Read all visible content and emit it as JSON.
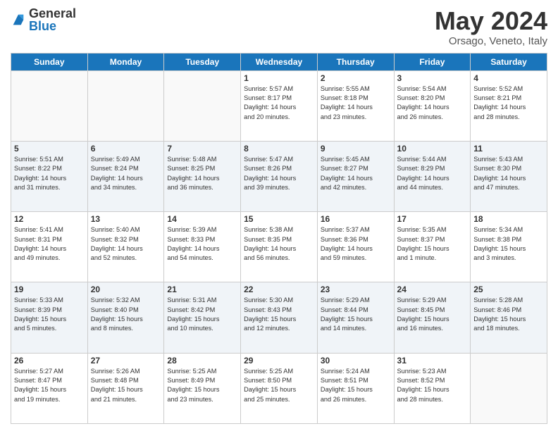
{
  "header": {
    "logo_general": "General",
    "logo_blue": "Blue",
    "month_title": "May 2024",
    "subtitle": "Orsago, Veneto, Italy"
  },
  "weekdays": [
    "Sunday",
    "Monday",
    "Tuesday",
    "Wednesday",
    "Thursday",
    "Friday",
    "Saturday"
  ],
  "weeks": [
    [
      {
        "day": "",
        "info": ""
      },
      {
        "day": "",
        "info": ""
      },
      {
        "day": "",
        "info": ""
      },
      {
        "day": "1",
        "info": "Sunrise: 5:57 AM\nSunset: 8:17 PM\nDaylight: 14 hours\nand 20 minutes."
      },
      {
        "day": "2",
        "info": "Sunrise: 5:55 AM\nSunset: 8:18 PM\nDaylight: 14 hours\nand 23 minutes."
      },
      {
        "day": "3",
        "info": "Sunrise: 5:54 AM\nSunset: 8:20 PM\nDaylight: 14 hours\nand 26 minutes."
      },
      {
        "day": "4",
        "info": "Sunrise: 5:52 AM\nSunset: 8:21 PM\nDaylight: 14 hours\nand 28 minutes."
      }
    ],
    [
      {
        "day": "5",
        "info": "Sunrise: 5:51 AM\nSunset: 8:22 PM\nDaylight: 14 hours\nand 31 minutes."
      },
      {
        "day": "6",
        "info": "Sunrise: 5:49 AM\nSunset: 8:24 PM\nDaylight: 14 hours\nand 34 minutes."
      },
      {
        "day": "7",
        "info": "Sunrise: 5:48 AM\nSunset: 8:25 PM\nDaylight: 14 hours\nand 36 minutes."
      },
      {
        "day": "8",
        "info": "Sunrise: 5:47 AM\nSunset: 8:26 PM\nDaylight: 14 hours\nand 39 minutes."
      },
      {
        "day": "9",
        "info": "Sunrise: 5:45 AM\nSunset: 8:27 PM\nDaylight: 14 hours\nand 42 minutes."
      },
      {
        "day": "10",
        "info": "Sunrise: 5:44 AM\nSunset: 8:29 PM\nDaylight: 14 hours\nand 44 minutes."
      },
      {
        "day": "11",
        "info": "Sunrise: 5:43 AM\nSunset: 8:30 PM\nDaylight: 14 hours\nand 47 minutes."
      }
    ],
    [
      {
        "day": "12",
        "info": "Sunrise: 5:41 AM\nSunset: 8:31 PM\nDaylight: 14 hours\nand 49 minutes."
      },
      {
        "day": "13",
        "info": "Sunrise: 5:40 AM\nSunset: 8:32 PM\nDaylight: 14 hours\nand 52 minutes."
      },
      {
        "day": "14",
        "info": "Sunrise: 5:39 AM\nSunset: 8:33 PM\nDaylight: 14 hours\nand 54 minutes."
      },
      {
        "day": "15",
        "info": "Sunrise: 5:38 AM\nSunset: 8:35 PM\nDaylight: 14 hours\nand 56 minutes."
      },
      {
        "day": "16",
        "info": "Sunrise: 5:37 AM\nSunset: 8:36 PM\nDaylight: 14 hours\nand 59 minutes."
      },
      {
        "day": "17",
        "info": "Sunrise: 5:35 AM\nSunset: 8:37 PM\nDaylight: 15 hours\nand 1 minute."
      },
      {
        "day": "18",
        "info": "Sunrise: 5:34 AM\nSunset: 8:38 PM\nDaylight: 15 hours\nand 3 minutes."
      }
    ],
    [
      {
        "day": "19",
        "info": "Sunrise: 5:33 AM\nSunset: 8:39 PM\nDaylight: 15 hours\nand 5 minutes."
      },
      {
        "day": "20",
        "info": "Sunrise: 5:32 AM\nSunset: 8:40 PM\nDaylight: 15 hours\nand 8 minutes."
      },
      {
        "day": "21",
        "info": "Sunrise: 5:31 AM\nSunset: 8:42 PM\nDaylight: 15 hours\nand 10 minutes."
      },
      {
        "day": "22",
        "info": "Sunrise: 5:30 AM\nSunset: 8:43 PM\nDaylight: 15 hours\nand 12 minutes."
      },
      {
        "day": "23",
        "info": "Sunrise: 5:29 AM\nSunset: 8:44 PM\nDaylight: 15 hours\nand 14 minutes."
      },
      {
        "day": "24",
        "info": "Sunrise: 5:29 AM\nSunset: 8:45 PM\nDaylight: 15 hours\nand 16 minutes."
      },
      {
        "day": "25",
        "info": "Sunrise: 5:28 AM\nSunset: 8:46 PM\nDaylight: 15 hours\nand 18 minutes."
      }
    ],
    [
      {
        "day": "26",
        "info": "Sunrise: 5:27 AM\nSunset: 8:47 PM\nDaylight: 15 hours\nand 19 minutes."
      },
      {
        "day": "27",
        "info": "Sunrise: 5:26 AM\nSunset: 8:48 PM\nDaylight: 15 hours\nand 21 minutes."
      },
      {
        "day": "28",
        "info": "Sunrise: 5:25 AM\nSunset: 8:49 PM\nDaylight: 15 hours\nand 23 minutes."
      },
      {
        "day": "29",
        "info": "Sunrise: 5:25 AM\nSunset: 8:50 PM\nDaylight: 15 hours\nand 25 minutes."
      },
      {
        "day": "30",
        "info": "Sunrise: 5:24 AM\nSunset: 8:51 PM\nDaylight: 15 hours\nand 26 minutes."
      },
      {
        "day": "31",
        "info": "Sunrise: 5:23 AM\nSunset: 8:52 PM\nDaylight: 15 hours\nand 28 minutes."
      },
      {
        "day": "",
        "info": ""
      }
    ]
  ]
}
